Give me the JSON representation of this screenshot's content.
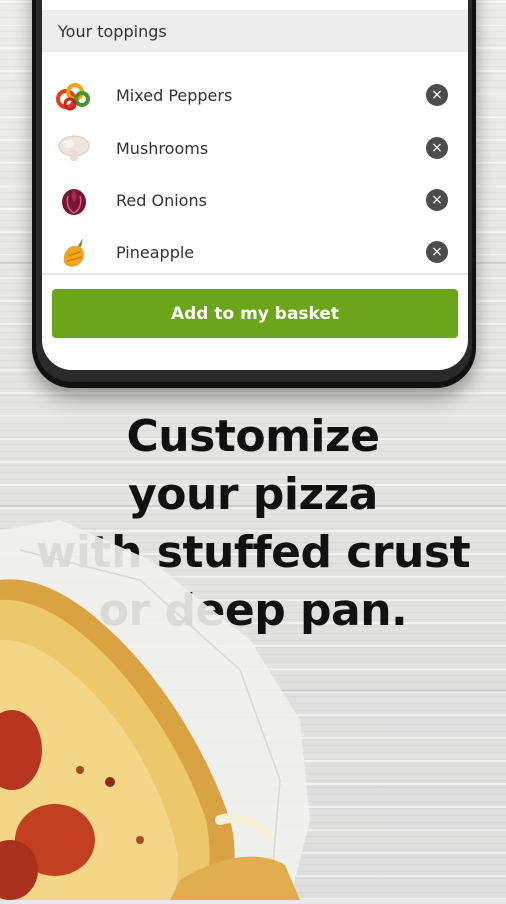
{
  "toppings_panel": {
    "header": "Your toppings",
    "items": [
      {
        "label": "Mixed Peppers",
        "icon": "mixed-peppers-icon"
      },
      {
        "label": "Mushrooms",
        "icon": "mushroom-icon"
      },
      {
        "label": "Red Onions",
        "icon": "red-onion-icon"
      },
      {
        "label": "Pineapple",
        "icon": "pineapple-icon"
      }
    ],
    "remove_symbol": "×",
    "basket_button": "Add to my basket"
  },
  "headline": {
    "line1": "Customize",
    "line2": "your pizza",
    "line3": "with stuffed crust",
    "line4": "or deep pan."
  },
  "colors": {
    "accent": "#6aa51a",
    "remove": "#4d4d4d"
  }
}
